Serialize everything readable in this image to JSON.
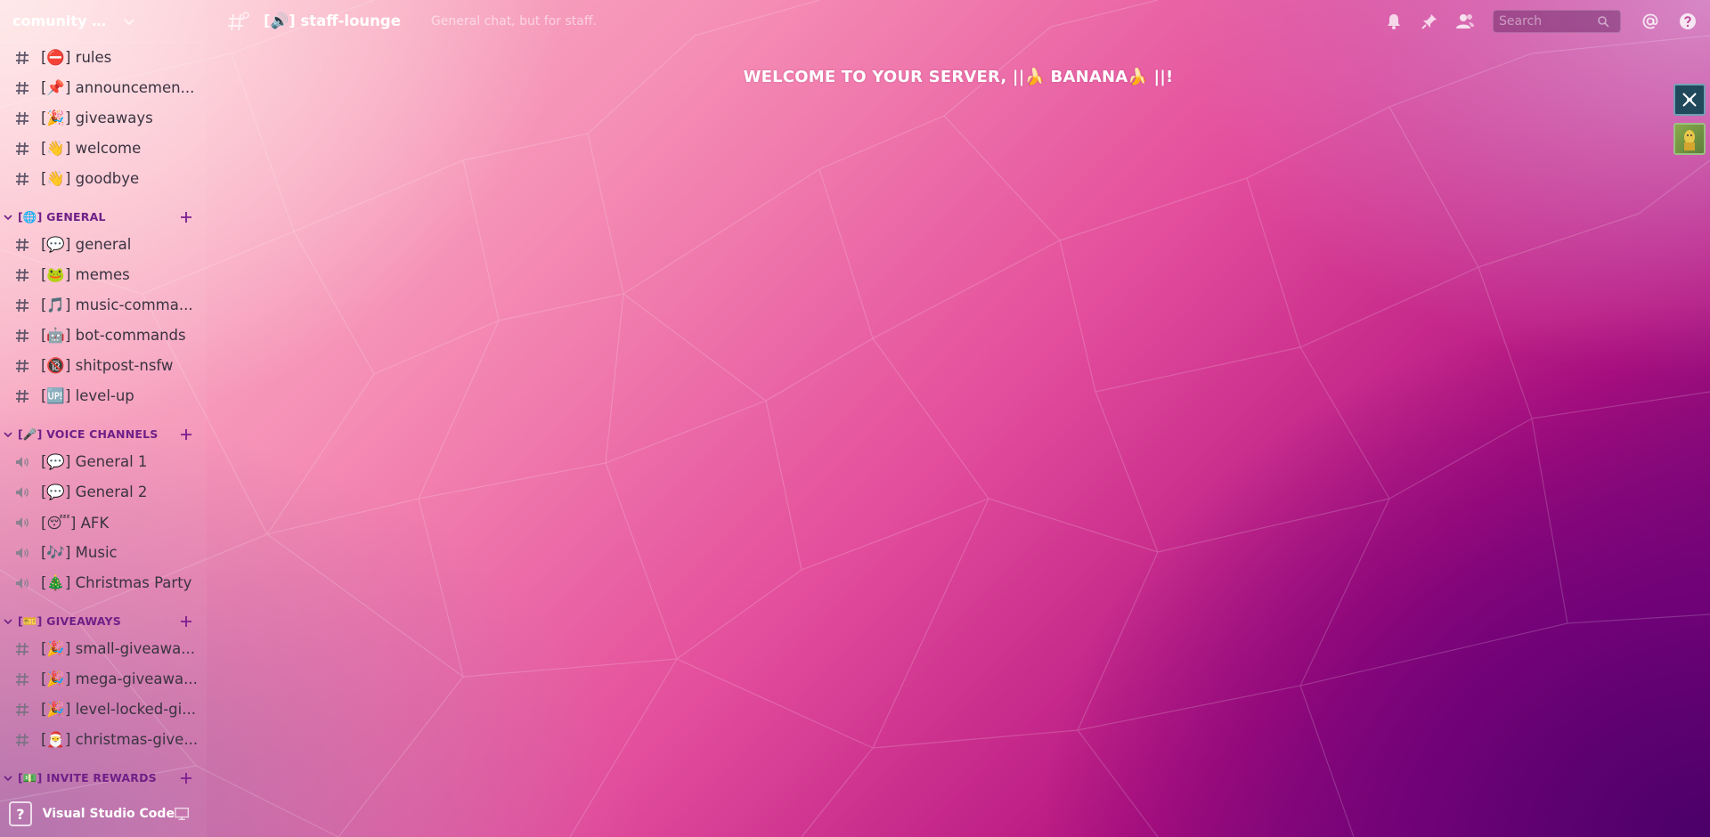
{
  "server": {
    "name": "comunity te..."
  },
  "header": {
    "channel_name": "[🔊] staff-lounge",
    "topic": "General chat, but for staff."
  },
  "toolbar": {
    "search_placeholder": "Search",
    "icons": [
      "bell-icon",
      "pin-icon",
      "members-icon",
      "search-icon",
      "mention-icon",
      "help-icon"
    ]
  },
  "channels_top": [
    {
      "type": "text",
      "label": "[⛔] rules"
    },
    {
      "type": "text",
      "label": "[📌] announcemen..."
    },
    {
      "type": "text",
      "label": "[🎉] giveaways"
    },
    {
      "type": "text",
      "label": "[👋] welcome"
    },
    {
      "type": "text",
      "label": "[👋] goodbye"
    }
  ],
  "categories": [
    {
      "name": "[🌐] GENERAL",
      "channels": [
        {
          "type": "text",
          "label": "[💬] general"
        },
        {
          "type": "text",
          "label": "[🐸] memes"
        },
        {
          "type": "text",
          "label": "[🎵] music-comma..."
        },
        {
          "type": "text",
          "label": "[🤖] bot-commands"
        },
        {
          "type": "text",
          "label": "[🔞] shitpost-nsfw"
        },
        {
          "type": "text",
          "label": "[🆙] level-up"
        }
      ]
    },
    {
      "name": "[🎤] VOICE CHANNELS",
      "channels": [
        {
          "type": "voice",
          "label": "[💬] General 1"
        },
        {
          "type": "voice",
          "label": "[💬] General 2"
        },
        {
          "type": "voice",
          "label": "[😴] AFK"
        },
        {
          "type": "voice",
          "label": "[🎶] Music"
        },
        {
          "type": "voice",
          "label": "[🎄] Christmas Party"
        }
      ]
    },
    {
      "name": "[🎫] GIVEAWAYS",
      "channels": [
        {
          "type": "text",
          "label": "[🎉] small-giveawa..."
        },
        {
          "type": "text",
          "label": "[🎉] mega-giveawa..."
        },
        {
          "type": "text",
          "label": "[🎉] level-locked-gi..."
        },
        {
          "type": "text",
          "label": "[🎅] christmas-give..."
        }
      ]
    },
    {
      "name": "[💵] INVITE REWARDS",
      "channels": []
    }
  ],
  "user_panel": {
    "help_glyph": "?",
    "activity": "Visual Studio Code"
  },
  "main": {
    "welcome": "WELCOME TO YOUR SERVER, ||🍌 BANANA🍌 ||!"
  },
  "colors": {
    "category_text": "#6e1f87",
    "channel_text": "#3a3340",
    "add_icon": "#7a1f8e"
  }
}
